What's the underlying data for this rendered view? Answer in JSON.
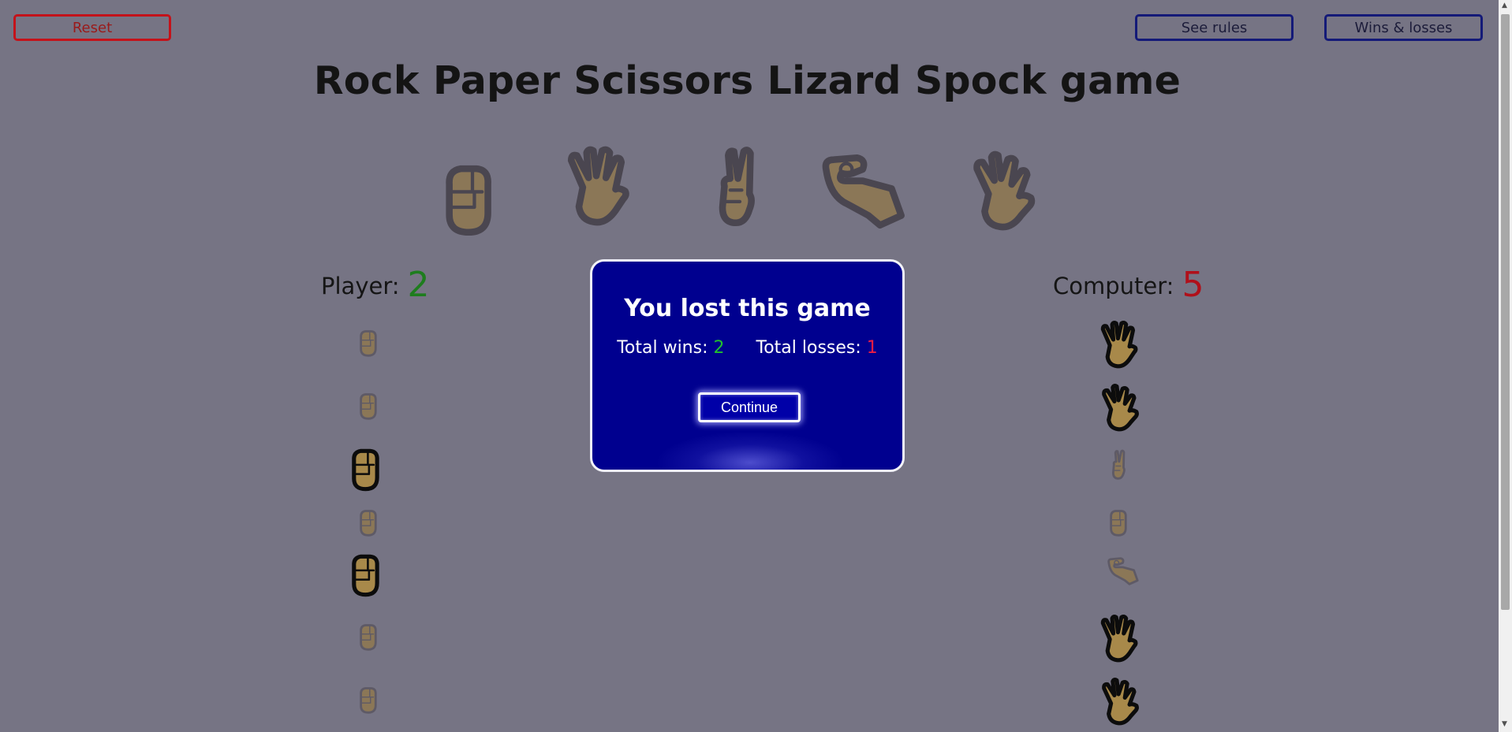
{
  "toolbar": {
    "reset_label": "Reset",
    "rules_label": "See rules",
    "wins_losses_label": "Wins & losses"
  },
  "title": "Rock Paper Scissors Lizard Spock game",
  "choices": [
    {
      "name": "rock",
      "icon": "fist-icon"
    },
    {
      "name": "paper",
      "icon": "open-hand-icon"
    },
    {
      "name": "scissors",
      "icon": "victory-hand-icon"
    },
    {
      "name": "lizard",
      "icon": "pinching-hand-icon"
    },
    {
      "name": "spock",
      "icon": "vulcan-salute-icon"
    }
  ],
  "player": {
    "label": "Player:",
    "score": "2",
    "history": [
      {
        "icon": "fist-icon",
        "won": false
      },
      {
        "icon": "fist-icon",
        "won": false
      },
      {
        "icon": "fist-icon",
        "won": true
      },
      {
        "icon": "fist-icon",
        "won": false
      },
      {
        "icon": "fist-icon",
        "won": true
      },
      {
        "icon": "fist-icon",
        "won": false
      },
      {
        "icon": "fist-icon",
        "won": false
      }
    ]
  },
  "computer": {
    "label": "Computer:",
    "score": "5",
    "history": [
      {
        "icon": "open-hand-icon",
        "won": true
      },
      {
        "icon": "vulcan-salute-icon",
        "won": true
      },
      {
        "icon": "victory-hand-icon",
        "won": false
      },
      {
        "icon": "fist-icon",
        "won": false
      },
      {
        "icon": "pinching-hand-icon",
        "won": false
      },
      {
        "icon": "open-hand-icon",
        "won": true
      },
      {
        "icon": "vulcan-salute-icon",
        "won": true
      }
    ]
  },
  "modal": {
    "title": "You lost this game",
    "wins_label": "Total wins:",
    "wins_value": "2",
    "losses_label": "Total losses:",
    "losses_value": "1",
    "continue_label": "Continue"
  },
  "colors": {
    "background": "#767484",
    "player_score": "#1e7d1e",
    "computer_score": "#b0101a",
    "modal_bg": "#00008f",
    "reset_border": "#c4121a",
    "nav_border": "#141a78",
    "hand_dim": "#8b7757",
    "hand_win": "#a8894a"
  }
}
